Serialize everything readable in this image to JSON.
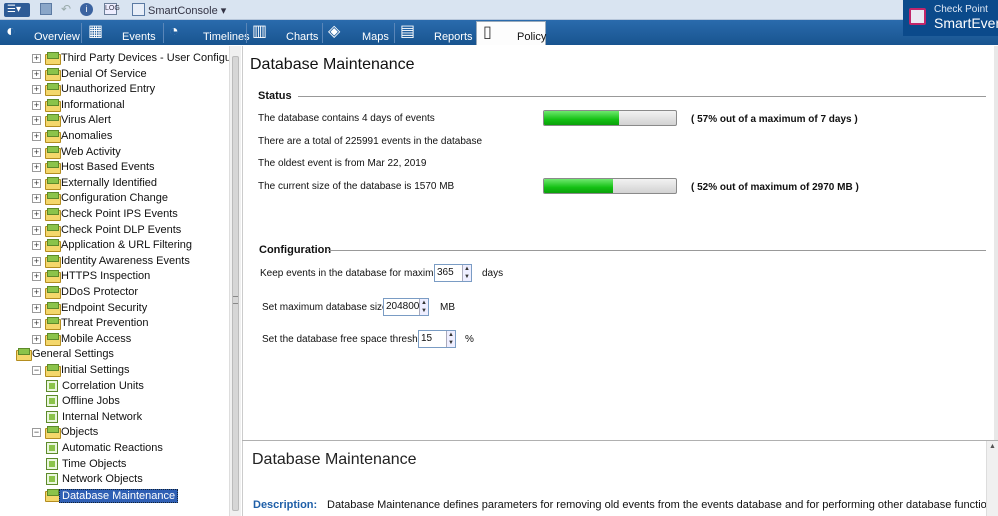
{
  "titlebar": {
    "console_label": "SmartConsole ▾",
    "info_glyph": "i",
    "log_glyph": "LOG",
    "menu_glyph": "☰▾",
    "undo_glyph": "↶"
  },
  "brand": {
    "top": "Check Point",
    "name": "SmartEvent"
  },
  "tabs": [
    {
      "label": "Overview",
      "icon": "gauge-icon"
    },
    {
      "label": "Events",
      "icon": "calendar-icon"
    },
    {
      "label": "Timelines",
      "icon": "clock-icon"
    },
    {
      "label": "Charts",
      "icon": "bar-chart-icon"
    },
    {
      "label": "Maps",
      "icon": "map-icon"
    },
    {
      "label": "Reports",
      "icon": "report-icon"
    },
    {
      "label": "Policy",
      "icon": "book-icon",
      "active": true
    }
  ],
  "tree": {
    "items": [
      {
        "label": "Third Party Devices - User Configured Event",
        "level": 1,
        "type": "folder",
        "expander": "+"
      },
      {
        "label": "Denial Of Service",
        "level": 1,
        "type": "folder",
        "expander": "+"
      },
      {
        "label": "Unauthorized Entry",
        "level": 1,
        "type": "folder",
        "expander": "+"
      },
      {
        "label": "Informational",
        "level": 1,
        "type": "folder",
        "expander": "+"
      },
      {
        "label": "Virus Alert",
        "level": 1,
        "type": "folder",
        "expander": "+"
      },
      {
        "label": "Anomalies",
        "level": 1,
        "type": "folder",
        "expander": "+"
      },
      {
        "label": "Web Activity",
        "level": 1,
        "type": "folder",
        "expander": "+"
      },
      {
        "label": "Host Based Events",
        "level": 1,
        "type": "folder",
        "expander": "+"
      },
      {
        "label": "Externally Identified",
        "level": 1,
        "type": "folder",
        "expander": "+"
      },
      {
        "label": "Configuration Change",
        "level": 1,
        "type": "folder",
        "expander": "+"
      },
      {
        "label": "Check Point IPS Events",
        "level": 1,
        "type": "folder",
        "expander": "+"
      },
      {
        "label": "Check Point DLP Events",
        "level": 1,
        "type": "folder",
        "expander": "+"
      },
      {
        "label": "Application & URL Filtering",
        "level": 1,
        "type": "folder",
        "expander": "+"
      },
      {
        "label": "Identity Awareness Events",
        "level": 1,
        "type": "folder",
        "expander": "+"
      },
      {
        "label": "HTTPS Inspection",
        "level": 1,
        "type": "folder",
        "expander": "+"
      },
      {
        "label": "DDoS Protector",
        "level": 1,
        "type": "folder",
        "expander": "+"
      },
      {
        "label": "Endpoint Security",
        "level": 1,
        "type": "folder",
        "expander": "+"
      },
      {
        "label": "Threat Prevention",
        "level": 1,
        "type": "folder",
        "expander": "+"
      },
      {
        "label": "Mobile Access",
        "level": 1,
        "type": "folder",
        "expander": "+"
      },
      {
        "label": "General Settings",
        "level": 0,
        "type": "folder",
        "expander": "−"
      },
      {
        "label": "Initial Settings",
        "level": 1,
        "type": "folder",
        "expander": "−"
      },
      {
        "label": "Correlation Units",
        "level": 2,
        "type": "leaf"
      },
      {
        "label": "Offline Jobs",
        "level": 2,
        "type": "leaf"
      },
      {
        "label": "Internal Network",
        "level": 2,
        "type": "leaf"
      },
      {
        "label": "Objects",
        "level": 1,
        "type": "folder",
        "expander": "−"
      },
      {
        "label": "Automatic Reactions",
        "level": 2,
        "type": "leaf"
      },
      {
        "label": "Time Objects",
        "level": 2,
        "type": "leaf"
      },
      {
        "label": "Network Objects",
        "level": 2,
        "type": "leaf"
      },
      {
        "label": "Database Maintenance",
        "level": 1,
        "type": "folder",
        "selected": true
      }
    ]
  },
  "main": {
    "title": "Database Maintenance",
    "status": {
      "heading": "Status",
      "days_text": "The database contains 4 days of events",
      "days_fraction": 0.57,
      "days_note": "( 57% out of a maximum of 7 days )",
      "total_text": "There are a total of 225991 events in the database",
      "oldest_text": "The oldest event is from Mar 22, 2019",
      "size_text": "The current size of the database is 1570 MB",
      "size_fraction": 0.52,
      "size_note": "( 52% out of maximum of 2970 MB )"
    },
    "configuration": {
      "heading": "Configuration",
      "keep_label": "Keep events in the database for maximum of",
      "keep_value": "365",
      "keep_unit": "days",
      "maxsize_label": "Set maximum database size to",
      "maxsize_value": "204800",
      "maxsize_unit": "MB",
      "free_label": "Set the database free space threshold to",
      "free_value": "15",
      "free_unit": "%"
    }
  },
  "help": {
    "title": "Database Maintenance",
    "desc_label": "Description:",
    "desc_text": "Database Maintenance defines parameters for removing old events from the events database and for performing other database functions."
  },
  "colors": {
    "tabbar": "#1f5f9f",
    "progress": "#14c114",
    "brand": "#0b4a8b",
    "selection": "#2f5fb4",
    "link": "#1f5fa8"
  }
}
